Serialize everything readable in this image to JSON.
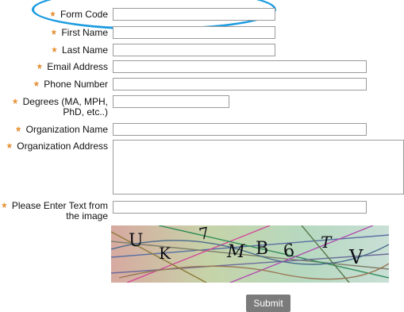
{
  "form": {
    "fields": [
      {
        "label": "Form Code",
        "value": "",
        "placeholder": ""
      },
      {
        "label": "First Name",
        "value": "",
        "placeholder": ""
      },
      {
        "label": "Last Name",
        "value": "",
        "placeholder": ""
      },
      {
        "label": "Email Address",
        "value": "",
        "placeholder": ""
      },
      {
        "label": "Phone Number",
        "value": "",
        "placeholder": ""
      },
      {
        "label_lines": [
          "Degrees (MA, MPH,",
          "PhD, etc..)"
        ],
        "value": "",
        "placeholder": ""
      },
      {
        "label": "Organization Name",
        "value": "",
        "placeholder": ""
      },
      {
        "label": "Organization Address",
        "value": "",
        "placeholder": ""
      },
      {
        "label_lines": [
          "Please Enter Text from",
          "the image"
        ],
        "value": "",
        "placeholder": ""
      }
    ],
    "captcha": {
      "characters": [
        "U",
        "K",
        "7",
        "M",
        "B",
        "6",
        "T",
        "V"
      ]
    },
    "submit_label": "Submit"
  },
  "colors": {
    "required_marker": "#d9822b",
    "highlight_circle": "#1b9be0",
    "submit_bg": "#7b7b7b",
    "input_border": "#9b9b9b"
  },
  "icons": {
    "required_marker": "required-asterisk-icon"
  }
}
